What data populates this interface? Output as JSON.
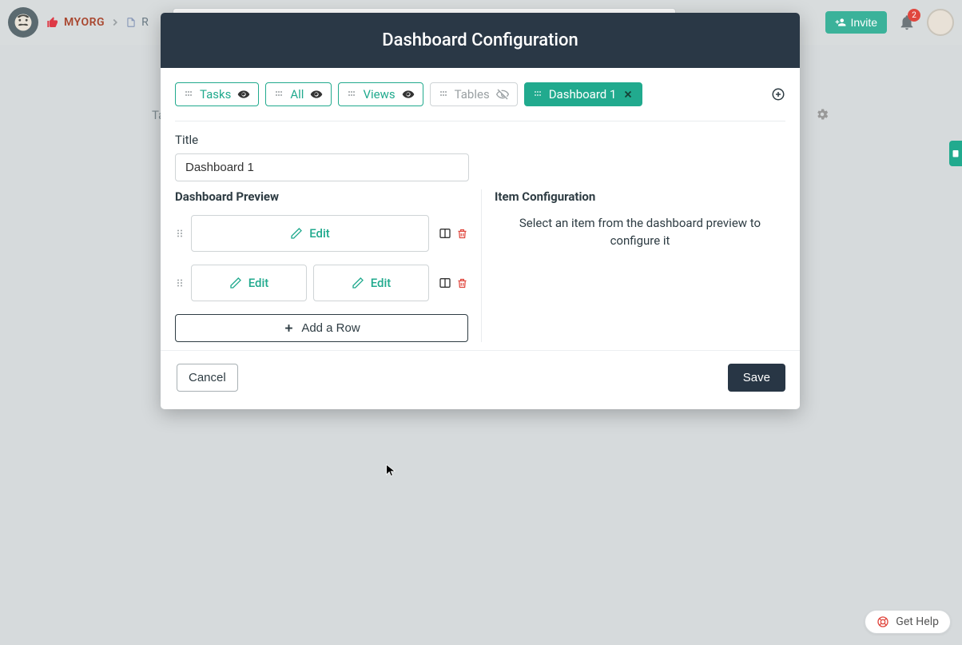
{
  "nav": {
    "org": "MYORG",
    "doc_prefix": "R",
    "invite": "Invite",
    "notifications": "2"
  },
  "bg": {
    "tab_fragment": "Ta"
  },
  "modal": {
    "title": "Dashboard Configuration",
    "tabs": [
      {
        "label": "Tasks",
        "state": "visible"
      },
      {
        "label": "All",
        "state": "visible"
      },
      {
        "label": "Views",
        "state": "visible"
      },
      {
        "label": "Tables",
        "state": "hidden"
      },
      {
        "label": "Dashboard 1",
        "state": "active"
      }
    ],
    "title_field_label": "Title",
    "title_value": "Dashboard 1",
    "preview_heading": "Dashboard Preview",
    "edit_label": "Edit",
    "add_row": "Add a Row",
    "config_heading": "Item Configuration",
    "config_help": "Select an item from the dashboard preview to configure it",
    "cancel": "Cancel",
    "save": "Save"
  },
  "help": {
    "label": "Get Help"
  }
}
